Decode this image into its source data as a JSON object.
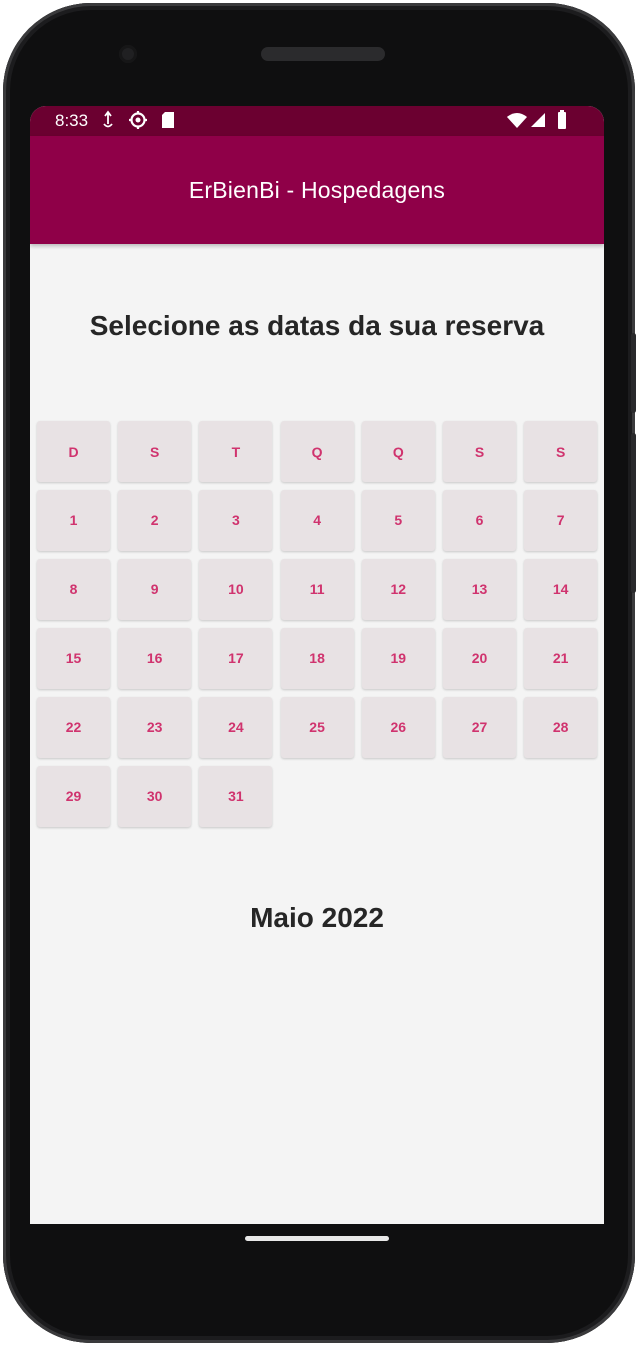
{
  "status_bar": {
    "time": "8:33",
    "left_icons": [
      "usb-debug-icon",
      "settings-gear-icon",
      "sd-card-icon"
    ],
    "right_icons": [
      "wifi-icon",
      "cellular-signal-icon",
      "battery-icon"
    ]
  },
  "app_bar": {
    "title": "ErBienBi - Hospedagens"
  },
  "main": {
    "heading": "Selecione as datas da sua reserva",
    "calendar": {
      "weekdays": [
        "D",
        "S",
        "T",
        "Q",
        "Q",
        "S",
        "S"
      ],
      "days": [
        "1",
        "2",
        "3",
        "4",
        "5",
        "6",
        "7",
        "8",
        "9",
        "10",
        "11",
        "12",
        "13",
        "14",
        "15",
        "16",
        "17",
        "18",
        "19",
        "20",
        "21",
        "22",
        "23",
        "24",
        "25",
        "26",
        "27",
        "28",
        "29",
        "30",
        "31"
      ],
      "first_weekday_index": 0
    },
    "month_label": "Maio 2022"
  },
  "colors": {
    "status_bar": "#6b0030",
    "app_bar": "#8f0048",
    "day_text": "#d0336e",
    "cell_bg": "#e8e2e4",
    "page_bg": "#f4f4f4"
  }
}
